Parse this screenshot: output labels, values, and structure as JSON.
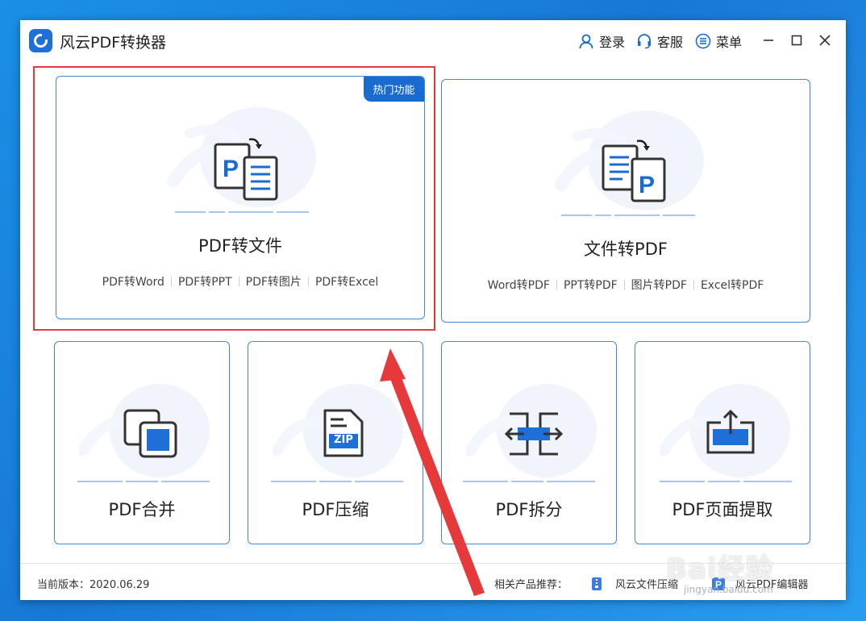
{
  "app": {
    "title": "风云PDF转换器"
  },
  "toolbar": {
    "login": "登录",
    "service": "客服",
    "menu": "菜单"
  },
  "cards": {
    "pdf_to_file": {
      "badge": "热门功能",
      "title": "PDF转文件",
      "links": [
        "PDF转Word",
        "PDF转PPT",
        "PDF转图片",
        "PDF转Excel"
      ]
    },
    "file_to_pdf": {
      "title": "文件转PDF",
      "links": [
        "Word转PDF",
        "PPT转PDF",
        "图片转PDF",
        "Excel转PDF"
      ]
    },
    "merge": {
      "title": "PDF合并"
    },
    "compress": {
      "title": "PDF压缩",
      "icon_text": "ZIP"
    },
    "split": {
      "title": "PDF拆分"
    },
    "extract": {
      "title": "PDF页面提取"
    }
  },
  "footer": {
    "version": "当前版本：2020.06.29",
    "recommend_label": "相关产品推荐：",
    "products": [
      "风云文件压缩",
      "风云PDF编辑器"
    ]
  },
  "watermark": {
    "text": "Bai经验",
    "url": "jingyan.baidu.com"
  },
  "colors": {
    "accent": "#1a6bd1",
    "card_border": "#3f8bd9",
    "annotation_red": "#e5393b",
    "background_blue": "#1878d6"
  }
}
